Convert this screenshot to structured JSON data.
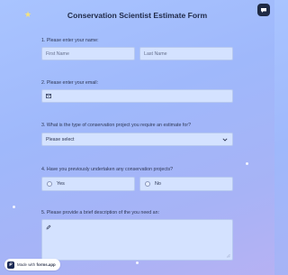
{
  "form": {
    "title": "Conservation Scientist Estimate Form",
    "q1": {
      "label": "1. Please enter your name:",
      "first_placeholder": "First Name",
      "last_placeholder": "Last Name"
    },
    "q2": {
      "label": "2. Please enter your email:",
      "icon": "email-icon"
    },
    "q3": {
      "label": "3. What is the type of conservation project you require an estimate for?",
      "selected": "Please select",
      "icon": "chevron-down-icon"
    },
    "q4": {
      "label": "4. Have you previously undertaken any conservation projects?",
      "options": [
        "Yes",
        "No"
      ]
    },
    "q5": {
      "label": "5. Please provide a brief description of the you need an:",
      "icon": "pencil-icon"
    }
  },
  "badge": {
    "prefix": "Made with",
    "brand": "forms.app"
  },
  "colors": {
    "accent_dark": "#1f2947",
    "field_bg": "#d4e2ff",
    "star": "#f6e27a"
  }
}
